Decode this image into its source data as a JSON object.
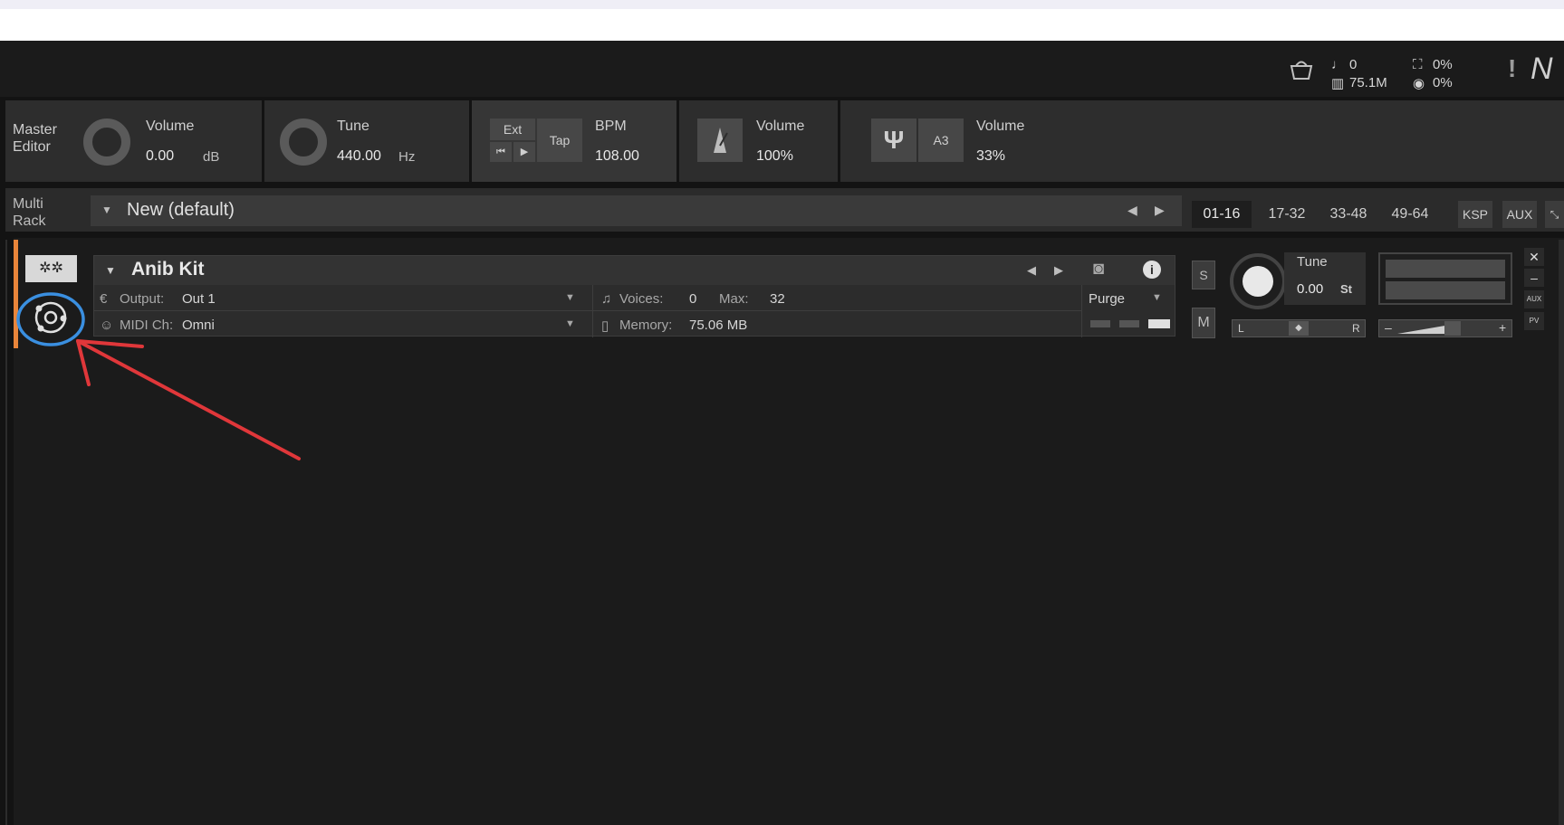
{
  "header": {
    "voices_count": "0",
    "memory": "75.1M",
    "cpu": "0%",
    "disk": "0%",
    "warning": "!",
    "logo_text": "N"
  },
  "master": {
    "title_line1": "Master",
    "title_line2": "Editor",
    "volume_label": "Volume",
    "volume_value": "0.00",
    "volume_unit": "dB",
    "tune_label": "Tune",
    "tune_value": "440.00",
    "tune_unit": "Hz",
    "ext_label": "Ext",
    "tap_label": "Tap",
    "bpm_label": "BPM",
    "bpm_value": "108.00",
    "metronome_volume_label": "Volume",
    "metronome_volume_value": "100%",
    "reference_note": "A3",
    "reference_volume_label": "Volume",
    "reference_volume_value": "33%"
  },
  "rack": {
    "title_line1": "Multi",
    "title_line2": "Rack",
    "preset_name": "New (default)",
    "pages": [
      "01-16",
      "17-32",
      "33-48",
      "49-64"
    ],
    "ksp_label": "KSP",
    "aux_label": "AUX"
  },
  "instrument": {
    "name": "Anib Kit",
    "output_label": "Output:",
    "output_value": "Out 1",
    "midi_label": "MIDI Ch:",
    "midi_value": "Omni",
    "voices_label": "Voices:",
    "voices_value": "0",
    "max_label": "Max:",
    "max_value": "32",
    "memory_label": "Memory:",
    "memory_value": "75.06 MB",
    "purge_label": "Purge",
    "solo_label": "S",
    "mute_label": "M",
    "tune_label": "Tune",
    "tune_value": "0.00",
    "tune_unit": "St",
    "pan_left": "L",
    "pan_right": "R",
    "volume_minus": "–",
    "volume_plus": "+",
    "aux_small": "AUX",
    "pv_small": "PV"
  },
  "colors": {
    "accent_orange": "#e9853a",
    "annotation_red": "#e0373a",
    "annotation_blue": "#3a8fe0"
  }
}
